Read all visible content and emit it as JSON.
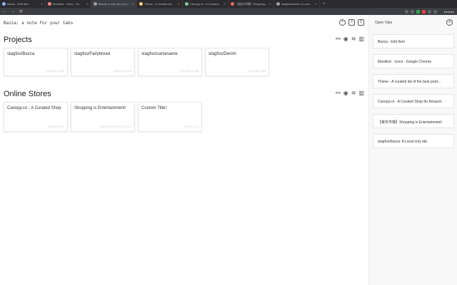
{
  "browser": {
    "tabs": [
      {
        "title": "Bazza - Edit Item",
        "color": "#8ab4f8"
      },
      {
        "title": "Manifest · Icons - Go...",
        "color": "#f28b82"
      },
      {
        "title": "Bazza: a note for your t...",
        "color": "#9aa0a6"
      },
      {
        "title": "Thieve - a curated list...",
        "color": "#fdd663"
      },
      {
        "title": "Canopy.co - A Curated...",
        "color": "#81c995"
      },
      {
        "title": "【楽天市場】Shopping...",
        "color": "#ee675c"
      },
      {
        "title": "stagfoo/bazza: A Loca...",
        "color": "#9aa0a6"
      }
    ],
    "new_tab": "+",
    "nav": [
      "←",
      "→",
      "⟳"
    ],
    "url": "",
    "extension_colors": [
      "#5f6368",
      "#5f6368",
      "#34a853",
      "#ea4335",
      "#5f6368",
      "#5f6368"
    ],
    "profile": "●●●●●●"
  },
  "app": {
    "title": "Bazza: a note for your tabs",
    "icons": [
      "plus-circle-icon",
      "layers-icon",
      "share-icon"
    ]
  },
  "sections": [
    {
      "title": "Projects",
      "cards": [
        {
          "title": "stagfoo/Bazza",
          "url": "GITHUB.COM"
        },
        {
          "title": "stagfoo/Fairybread",
          "url": "GITHUB.COM"
        },
        {
          "title": "stagfoo/samesame",
          "url": "GITHUB.COM"
        },
        {
          "title": "stagfoo/Denim",
          "url": "GITHUB.COM"
        }
      ]
    },
    {
      "title": "Online Stores",
      "cards": [
        {
          "title": "Canopy.co - A Curated Shop",
          "url": "CANOPY.CO"
        },
        {
          "title": "Shopping is Entertainment!",
          "url": "WWW.RAKUTEN.CO.JP"
        },
        {
          "title": "Custom Title!",
          "url": "THIEVE.CO"
        }
      ]
    }
  ],
  "section_icons": [
    "link-icon",
    "eye-icon",
    "layers-icon",
    "trash-icon"
  ],
  "sidebar": {
    "heading": "Open Tabs",
    "items": [
      "Bazza - Edit Item",
      "Manifest · Icons - Google Chrome",
      "Thieve - A curated list of the best prod...",
      "Canopy.co - A Curated Shop for Amazon",
      "【楽天市場】Shopping is Entertainment!",
      "stagfoo/bazza: A Local only tab"
    ]
  }
}
